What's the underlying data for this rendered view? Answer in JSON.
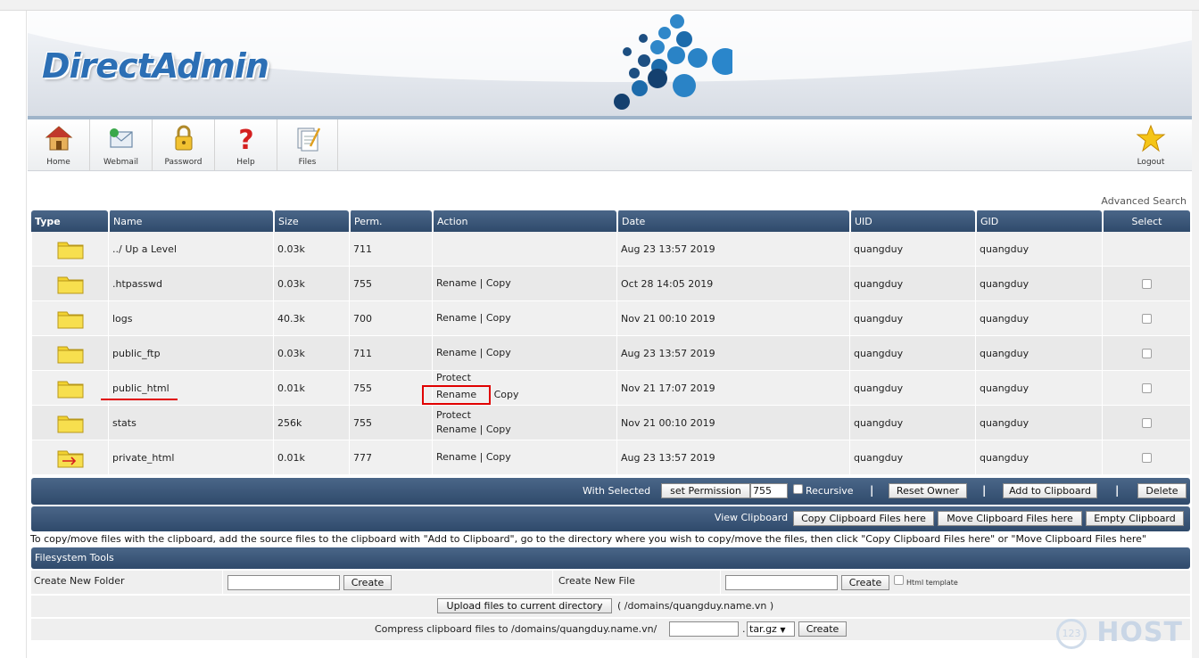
{
  "app": {
    "logo_text": "DirectAdmin"
  },
  "toolbar": {
    "items": [
      {
        "label": "Home",
        "icon": "home-icon"
      },
      {
        "label": "Webmail",
        "icon": "mail-icon"
      },
      {
        "label": "Password",
        "icon": "lock-icon"
      },
      {
        "label": "Help",
        "icon": "question-icon"
      },
      {
        "label": "Files",
        "icon": "files-icon"
      }
    ],
    "logout": {
      "label": "Logout",
      "icon": "star-icon"
    }
  },
  "advanced_search": "Advanced Search",
  "table": {
    "headers": {
      "type": "Type",
      "name": "Name",
      "size": "Size",
      "perm": "Perm.",
      "action": "Action",
      "date": "Date",
      "uid": "UID",
      "gid": "GID",
      "select": "Select"
    },
    "rows": [
      {
        "name": "../ Up a Level",
        "size": "0.03k",
        "perm": "711",
        "protect": "",
        "rename": "",
        "sep": "",
        "copy": "",
        "date": "Aug 23 13:57 2019",
        "uid": "quangduy",
        "gid": "quangduy",
        "icon": "folder-icon"
      },
      {
        "name": ".htpasswd",
        "size": "0.03k",
        "perm": "755",
        "protect": "",
        "rename": "Rename",
        "sep": "|",
        "copy": "Copy",
        "date": "Oct 28 14:05 2019",
        "uid": "quangduy",
        "gid": "quangduy",
        "icon": "folder-icon"
      },
      {
        "name": "logs",
        "size": "40.3k",
        "perm": "700",
        "protect": "",
        "rename": "Rename",
        "sep": "|",
        "copy": "Copy",
        "date": "Nov 21 00:10 2019",
        "uid": "quangduy",
        "gid": "quangduy",
        "icon": "folder-icon"
      },
      {
        "name": "public_ftp",
        "size": "0.03k",
        "perm": "711",
        "protect": "",
        "rename": "Rename",
        "sep": "|",
        "copy": "Copy",
        "date": "Aug 23 13:57 2019",
        "uid": "quangduy",
        "gid": "quangduy",
        "icon": "folder-icon"
      },
      {
        "name": "public_html",
        "size": "0.01k",
        "perm": "755",
        "protect": "Protect",
        "rename": "Rename",
        "sep": "|",
        "copy": "Copy",
        "date": "Nov 21 17:07 2019",
        "uid": "quangduy",
        "gid": "quangduy",
        "icon": "folder-icon"
      },
      {
        "name": "stats",
        "size": "256k",
        "perm": "755",
        "protect": "Protect",
        "rename": "Rename",
        "sep": "|",
        "copy": "Copy",
        "date": "Nov 21 00:10 2019",
        "uid": "quangduy",
        "gid": "quangduy",
        "icon": "folder-icon"
      },
      {
        "name": "private_html",
        "size": "0.01k",
        "perm": "777",
        "protect": "",
        "rename": "Rename",
        "sep": "|",
        "copy": "Copy",
        "date": "Aug 23 13:57 2019",
        "uid": "quangduy",
        "gid": "quangduy",
        "icon": "folder-link-icon"
      }
    ]
  },
  "selected_bar": {
    "label": "With Selected",
    "set_permission": "set Permission",
    "perm_value": "755",
    "recursive": "Recursive",
    "reset_owner": "Reset Owner",
    "add_clipboard": "Add to Clipboard",
    "delete": "Delete",
    "sep": "|"
  },
  "clipboard_bar": {
    "view": "View Clipboard",
    "copy_here": "Copy Clipboard Files here",
    "move_here": "Move Clipboard Files here",
    "empty": "Empty Clipboard"
  },
  "help_text": "To copy/move files with the clipboard, add the source files to the clipboard with \"Add to Clipboard\", go to the directory where you wish to copy/move the files, then click \"Copy Clipboard Files here\" or \"Move Clipboard Files here\"",
  "fs_tools": {
    "title": "Filesystem Tools",
    "new_folder_label": "Create New Folder",
    "new_file_label": "Create New File",
    "create": "Create",
    "html_template": "Html template",
    "upload": "Upload files to current directory",
    "upload_path": "( /domains/quangduy.name.vn )",
    "compress_label": "Compress clipboard files to /domains/quangduy.name.vn/",
    "dot": ".",
    "compress_ext": "tar.gz"
  },
  "watermark": {
    "circle": "123",
    "text": "HOST"
  }
}
